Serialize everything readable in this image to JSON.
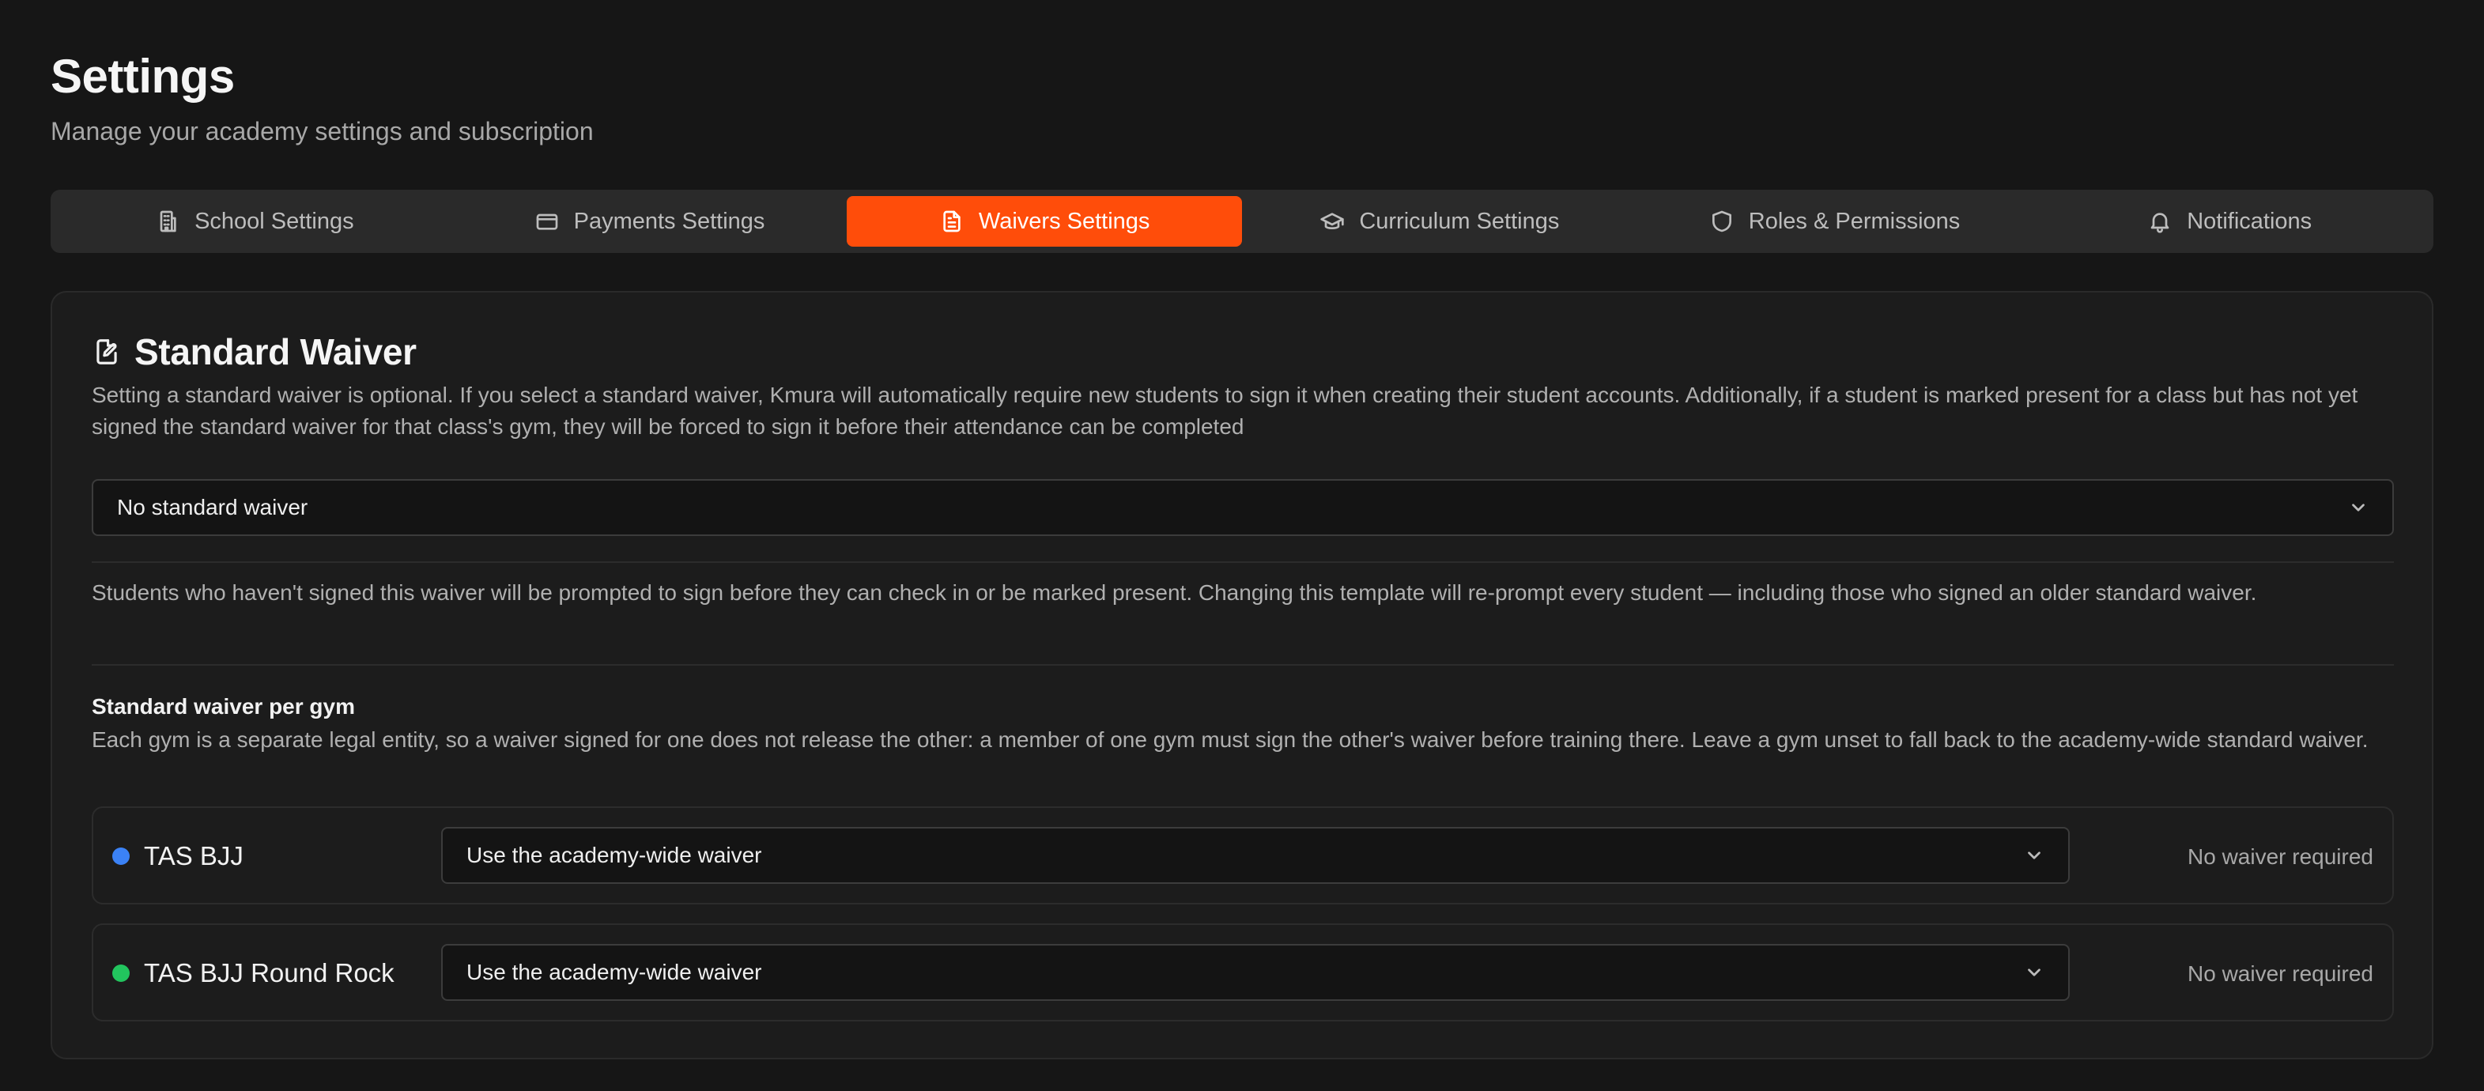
{
  "header": {
    "title": "Settings",
    "subtitle": "Manage your academy settings and subscription"
  },
  "tabs": [
    {
      "label": "School Settings",
      "icon": "building-icon",
      "active": false
    },
    {
      "label": "Payments Settings",
      "icon": "credit-card-icon",
      "active": false
    },
    {
      "label": "Waivers Settings",
      "icon": "document-icon",
      "active": true
    },
    {
      "label": "Curriculum Settings",
      "icon": "graduation-cap-icon",
      "active": false
    },
    {
      "label": "Roles & Permissions",
      "icon": "shield-icon",
      "active": false
    },
    {
      "label": "Notifications",
      "icon": "bell-icon",
      "active": false
    }
  ],
  "waiver": {
    "title": "Standard Waiver",
    "description": "Setting a standard waiver is optional. If you select a standard waiver, Kmura will automatically require new students to sign it when creating their student accounts. Additionally, if a student is marked present for a class but has not yet signed the standard waiver for that class's gym, they will be forced to sign it before their attendance can be completed",
    "select_value": "No standard waiver",
    "note": "Students who haven't signed this waiver will be prompted to sign before they can check in or be marked present. Changing this template will re-prompt every student — including those who signed an older standard waiver."
  },
  "per_gym": {
    "title": "Standard waiver per gym",
    "description": "Each gym is a separate legal entity, so a waiver signed for one does not release the other: a member of one gym must sign the other's waiver before training there. Leave a gym unset to fall back to the academy-wide standard waiver.",
    "gyms": [
      {
        "name": "TAS BJJ",
        "dot_color": "#3b82f6",
        "select_value": "Use the academy-wide waiver",
        "status": "No waiver required"
      },
      {
        "name": "TAS BJJ Round Rock",
        "dot_color": "#22c55e",
        "select_value": "Use the academy-wide waiver",
        "status": "No waiver required"
      }
    ]
  },
  "colors": {
    "accent": "#ff4d0a",
    "background": "#161616",
    "card": "#1c1c1c"
  }
}
